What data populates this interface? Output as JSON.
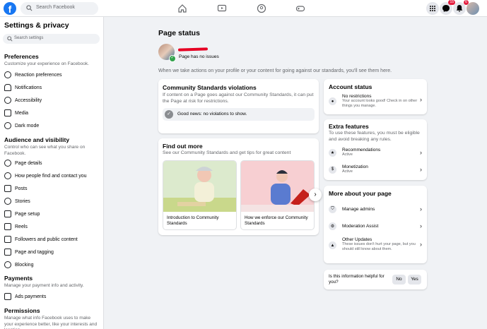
{
  "topbar": {
    "logo_letter": "f",
    "search_placeholder": "Search Facebook",
    "nav_icons": [
      "home-icon",
      "watch-icon",
      "groups-icon",
      "gaming-icon"
    ],
    "messenger_badge": "15",
    "notifications_badge": "6"
  },
  "sidebar": {
    "title": "Settings & privacy",
    "search_placeholder": "Search settings",
    "preferences": {
      "heading": "Preferences",
      "desc": "Customize your experience on Facebook.",
      "items": [
        "Reaction preferences",
        "Notifications",
        "Accessibility",
        "Media",
        "Dark mode"
      ]
    },
    "audience": {
      "heading": "Audience and visibility",
      "desc": "Control who can see what you share on Facebook.",
      "items": [
        "Page details",
        "How people find and contact you",
        "Posts",
        "Stories",
        "Page setup",
        "Reels",
        "Followers and public content",
        "Page and tagging",
        "Blocking"
      ]
    },
    "payments": {
      "heading": "Payments",
      "desc": "Manage your payment info and activity.",
      "items": [
        "Ads payments"
      ]
    },
    "permissions": {
      "heading": "Permissions",
      "desc": "Manage what info Facebook uses to make your experience better, like your interests and location."
    }
  },
  "main": {
    "title": "Page status",
    "page_status": "Page has no issues",
    "description": "When we take actions on your profile or your content for going against our standards, you'll see them here.",
    "violations": {
      "title": "Community Standards violations",
      "desc": "If content on a Page goes against our Community Standards, it can put the Page at risk for restrictions.",
      "news": "Good news: no violations to show."
    },
    "find_out": {
      "title": "Find out more",
      "desc": "See our Community Standards and get tips for great content",
      "tiles": [
        "Introduction to Community Standards",
        "How we enforce our Community Standards"
      ]
    }
  },
  "right": {
    "account_status": {
      "title": "Account status",
      "item_title": "No restrictions",
      "item_desc": "Your account looks good! Check in on other things you manage."
    },
    "extra": {
      "title": "Extra features",
      "desc": "To use these features, you must be eligible and avoid breaking any rules.",
      "items": [
        {
          "title": "Recommendations",
          "status": "Active"
        },
        {
          "title": "Monetization",
          "status": "Active"
        }
      ]
    },
    "more": {
      "title": "More about your page",
      "items": [
        "Manage admins",
        "Moderation Assist"
      ],
      "other_title": "Other Updates",
      "other_desc": "These issues don't hurt your page, but you should still know about them."
    },
    "helpful": {
      "question": "Is this information helpful for you?",
      "no": "No",
      "yes": "Yes"
    }
  },
  "colors": {
    "brand": "#1877f2",
    "badge": "#e41e3f",
    "success": "#31a24c",
    "background": "#f0f2f5"
  }
}
